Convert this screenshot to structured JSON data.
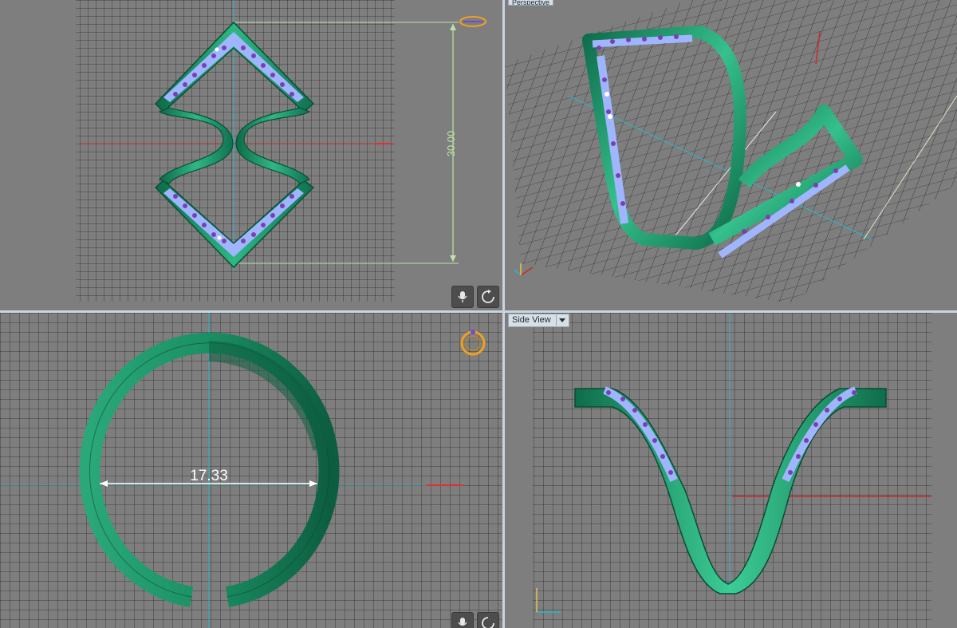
{
  "viewports": {
    "top": {
      "dimension": "30.00"
    },
    "perspective": {
      "label": "Perspective"
    },
    "front": {
      "dimension": "17.33"
    },
    "side": {
      "label": "Side View"
    }
  },
  "icons": {
    "microphone": "microphone-icon",
    "rotate": "rotate-icon",
    "ring_thumbnail": "ring-thumbnail-icon",
    "view_dropdown": "chevron-down-icon"
  },
  "colors": {
    "metal": "#1f9a6f",
    "metal_dark": "#0e6e4c",
    "metal_light": "#48c99a",
    "gem_blue": "#9fb6ff",
    "gem_purple": "#7a3fb3",
    "grid_bg": "#7d7d7d",
    "grid_line": "#2c2c2c",
    "axis_red": "#c62a2a",
    "axis_cyan": "#2bb5c9",
    "dimension_line": "#bfe2a8",
    "thumbnail": "#f0a020"
  }
}
